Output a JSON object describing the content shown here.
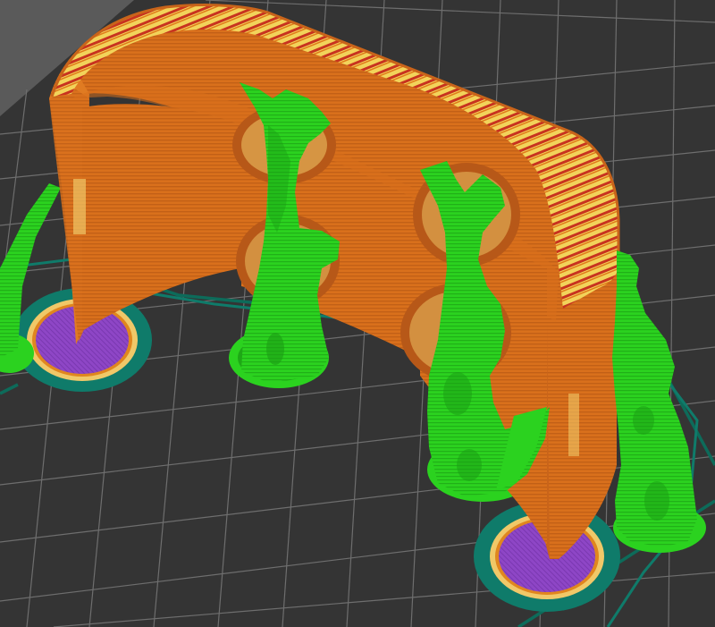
{
  "app": {
    "view": "slicer-preview-3d"
  },
  "colors": {
    "background": "#5a5a5a",
    "bed": "#343434",
    "grid": "#6e6e6e",
    "perimeter": "#f07a1a",
    "perimeter_dark": "#c8621a",
    "infill_yellow": "#f2d35a",
    "infill_red": "#c8331f",
    "support": "#2bd21f",
    "support_dark": "#1a9c14",
    "brim_teal": "#0f7b6a",
    "skirt_teal": "#0d6b5a",
    "first_layer_purple": "#8e46c6",
    "first_layer_ring": "#f0c868"
  },
  "icons": {
    "bed": "print-bed-icon",
    "part": "printed-part-icon",
    "supports": "support-tree-icon"
  }
}
